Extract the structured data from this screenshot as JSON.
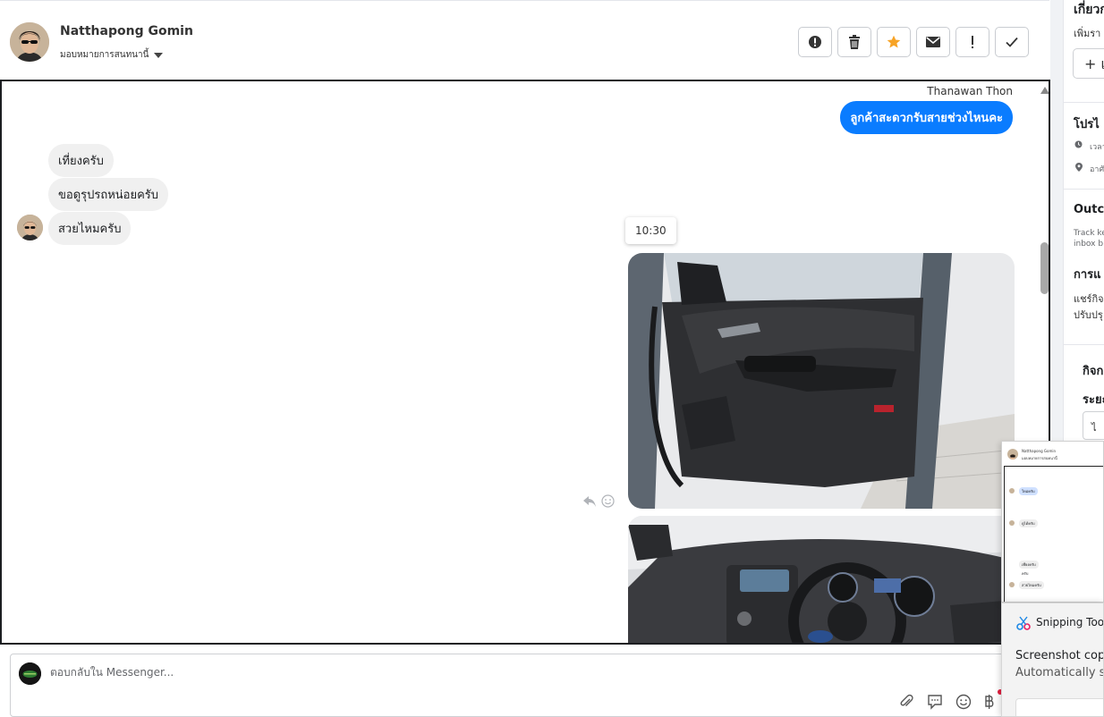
{
  "header": {
    "name": "Natthapong Gomin",
    "assign_label": "มอบหมายการสนทนานี้"
  },
  "chat": {
    "sender_label": "Thanawan Thon",
    "outgoing": [
      {
        "text": "ลูกค้าสะดวกรับสายช่วงไหนคะ"
      }
    ],
    "incoming": [
      {
        "text": "เที่ยงครับ"
      },
      {
        "text": "ขอดูรุปรถหน่อยครับ"
      },
      {
        "text": "สวยไหมครับ"
      }
    ],
    "time_tooltip": "10:30"
  },
  "composer": {
    "placeholder": "ตอบกลับใน Messenger..."
  },
  "sidebar": {
    "section1_title": "เกี่ยวก",
    "section1_sub": "เพิ่มรา",
    "add_button": "+ เ",
    "section2_title": "โปรไ",
    "time_row": "เวลา",
    "location_row": "อาศั",
    "outcome_title": "Outc",
    "outcome_desc_1": "Track ke",
    "outcome_desc_2": "inbox b",
    "section3_title": "การแ",
    "section3_desc_1": "แชร์กิจ",
    "section3_desc_2": "ปรับปรุ",
    "activity_title": "กิจก",
    "period_label": "ระยะ",
    "select_value": "ไ"
  },
  "snip_preview": {
    "name": "Natthapong Gomin",
    "sub": "มอบหมายการสนทนานี้",
    "b1": "ใหม่ครับ",
    "b2": "ดูได้ครับ",
    "b3": "เที่ยงครับ",
    "b4": "ครับ",
    "b5": "สวยไหมครับ"
  },
  "toast": {
    "app_name": "Snipping Tool",
    "title": "Screenshot copied to clipboard",
    "body": "Automatically saved to screenshots folder"
  },
  "colors": {
    "accent": "#0a7cff",
    "star": "#f7a325"
  }
}
